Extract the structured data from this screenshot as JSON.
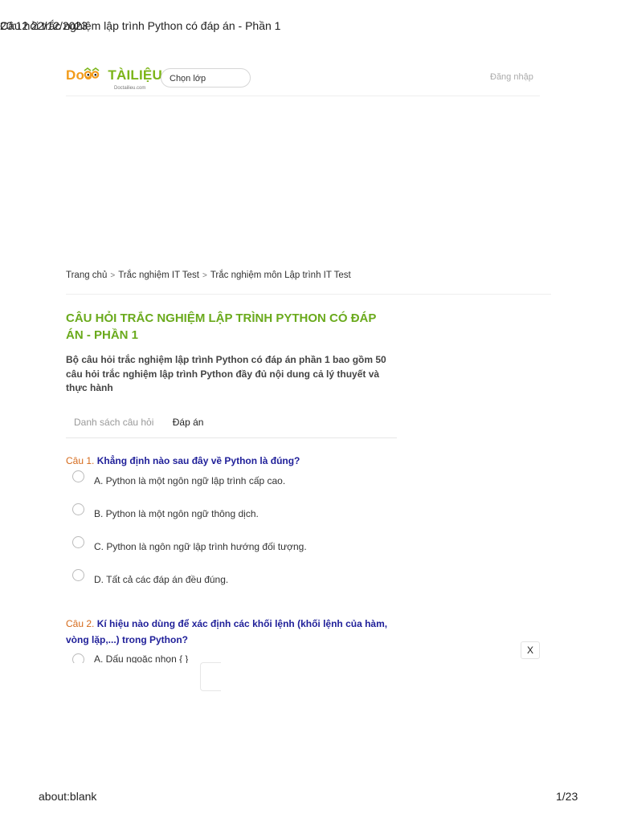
{
  "print_header": {
    "datetime": "20:12 22/12/2023",
    "title": "Câu hỏi trắc nghiệm lập trình Python có đáp án - Phần 1"
  },
  "site": {
    "logo_doc": "Doc",
    "logo_tailieu": "TÀILIỆU",
    "logo_sub": "Doctailieu.com",
    "class_select": "Chọn lớp",
    "login": "Đăng nhập"
  },
  "breadcrumb": [
    "Trang chủ",
    "Trắc nghiệm IT Test",
    "Trắc nghiệm môn Lập trình IT Test"
  ],
  "page_title": "CÂU HỎI TRẮC NGHIỆM LẬP TRÌNH PYTHON CÓ ĐÁP ÁN - PHẦN 1",
  "intro": "Bộ câu hỏi trắc nghiệm lập trình Python có đáp án phần 1 bao gồm 50 câu hỏi trắc nghiệm lập trình Python đầy đủ nội dung cả lý thuyết và thực hành",
  "tabs": [
    "Danh sách câu hỏi",
    "Đáp án"
  ],
  "questions": [
    {
      "num": "Câu 1.",
      "text": "Khẳng định nào sau đây về Python là đúng?",
      "options": [
        "A. Python là một ngôn ngữ lập trình cấp cao.",
        "B. Python là một ngôn ngữ thông dịch.",
        "C. Python là ngôn ngữ lập trình hướng đối tượng.",
        "D. Tất cả các đáp án đều đúng."
      ]
    },
    {
      "num": "Câu 2.",
      "text": "Kí hiệu nào dùng để xác định các khối lệnh (khối lệnh của hàm, vòng lặp,...) trong Python?",
      "options": [
        "A. Dấu ngoặc nhọn { }"
      ]
    }
  ],
  "close_label": "X",
  "print_footer": {
    "url": "about:blank",
    "page": "1/23"
  }
}
